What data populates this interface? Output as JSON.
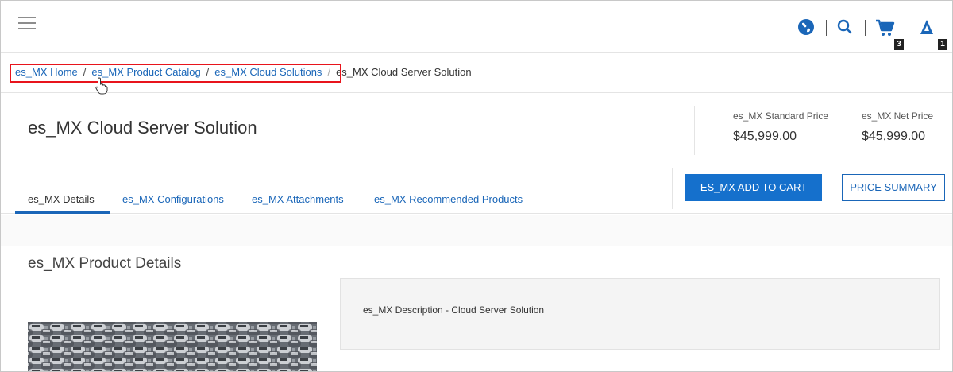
{
  "topbar": {
    "icons": [
      "menu-icon",
      "globe-icon",
      "search-icon",
      "cart-icon",
      "account-icon"
    ],
    "cart_count": "3",
    "account_count": "1",
    "icon_color": "#1a66b8"
  },
  "breadcrumb": {
    "items": [
      "es_MX Home",
      "es_MX Product Catalog",
      "es_MX Cloud Solutions"
    ],
    "separator": "/",
    "current": "es_MX Cloud Server Solution",
    "highlight_color": "#e8141c"
  },
  "product": {
    "title": "es_MX Cloud Server Solution",
    "standard_price_label": "es_MX Standard Price",
    "standard_price": "$45,999.00",
    "net_price_label": "es_MX Net Price",
    "net_price": "$45,999.00"
  },
  "tabs": [
    {
      "label": "es_MX Details",
      "active": true
    },
    {
      "label": "es_MX Configurations",
      "active": false
    },
    {
      "label": "es_MX Attachments",
      "active": false
    },
    {
      "label": "es_MX Recommended Products",
      "active": false
    }
  ],
  "actions": {
    "add_to_cart": "ES_MX ADD TO CART",
    "price_summary": "PRICE SUMMARY"
  },
  "details": {
    "heading": "es_MX Product Details",
    "description": "es_MX Description - Cloud Server Solution"
  },
  "colors": {
    "accent": "#1570cc",
    "link": "#1a66b8"
  }
}
